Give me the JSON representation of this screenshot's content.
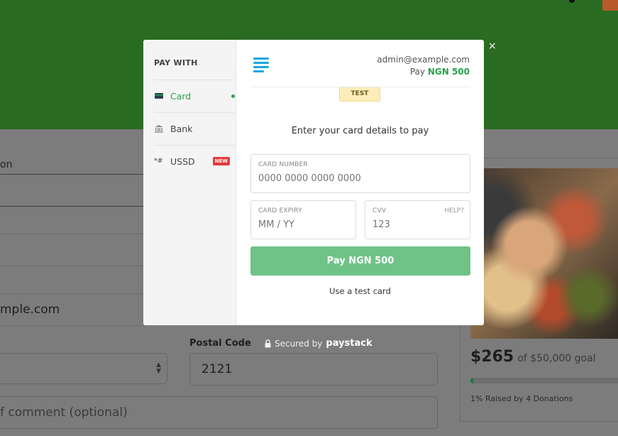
{
  "background": {
    "field_label_partial": "on",
    "email_partial": "mple.com",
    "postal_label": "Postal Code",
    "postal_value": "2121",
    "comment_placeholder": "f comment (optional)",
    "amount_raised": "$265",
    "goal": "of $50,000 goal",
    "progress_percent": 1,
    "raised_text": "1% Raised by 4 Donations",
    "secured_prefix": "Secured by",
    "secured_brand": "paystack"
  },
  "modal": {
    "sidebar": {
      "title": "PAY WITH",
      "items": [
        {
          "label": "Card",
          "icon": "card-icon",
          "active": true
        },
        {
          "label": "Bank",
          "icon": "bank-icon",
          "active": false
        },
        {
          "label": "USSD",
          "icon": "ussd-icon",
          "active": false,
          "badge": "NEW"
        }
      ]
    },
    "merchant_email": "admin@example.com",
    "pay_prefix": "Pay",
    "pay_amount": "NGN 500",
    "test_badge": "TEST",
    "instruction": "Enter your card details to pay",
    "card_number": {
      "label": "CARD NUMBER",
      "placeholder": "0000 0000 0000 0000"
    },
    "card_expiry": {
      "label": "CARD EXPIRY",
      "placeholder": "MM / YY"
    },
    "cvv": {
      "label": "CVV",
      "placeholder": "123",
      "help": "HELP?"
    },
    "pay_button": "Pay NGN 500",
    "test_card_link": "Use a test card",
    "close_symbol": "×"
  },
  "colors": {
    "accent": "#27a24a",
    "button": "#6fc386",
    "badge_new": "#e23b3b",
    "test_badge": "#fcedba"
  }
}
